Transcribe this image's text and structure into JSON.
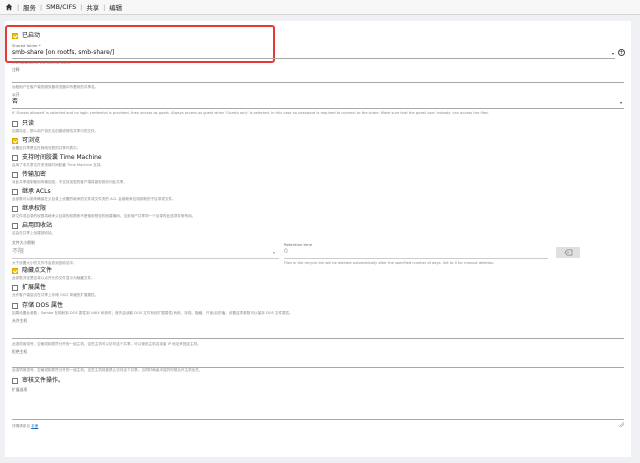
{
  "breadcrumb": [
    "服务",
    "SMB/CIFS",
    "共享",
    "编辑"
  ],
  "form": {
    "enabled": {
      "label": "已启动",
      "checked": true
    },
    "shared_folder": {
      "label": "Shared folder *",
      "value": "smb-share [on rootfs, smb-share/]",
      "hint": "The location of the files to share."
    },
    "comment": {
      "label": "注释",
      "value": "",
      "hint": "远程用户在客户端的服务器浏览器中所看到的共享名。"
    },
    "public": {
      "label": "公开",
      "value": "否",
      "hint": "If 'Guests allowed' is selected and no login credential is provided, then access as guest. Always access as guest when 'Guests only' is selected. In this case no password is required to connect to the share. Make sure that the guest user 'nobody' can access the files."
    },
    "readonly": {
      "label": "只读",
      "checked": false,
      "hint": "如果设定，那么用户将无法创建或修改共享中的文件。"
    },
    "browseable": {
      "label": "可浏览",
      "checked": true,
      "hint": "设置此共享是否在网络邻居的共享列表中。"
    },
    "time_machine": {
      "label": "支持时间胶囊 Time Machine",
      "checked": false,
      "hint": "启用了本共享文件夹采用时间胶囊 Time Machine 支持。"
    },
    "transport_encryption": {
      "label": "传输加密",
      "checked": false,
      "hint": "对此共享强制使用传输加密。不支持加密的客户端将被拒绝访问此共享。"
    },
    "inherit_acls": {
      "label": "继承 ACLs",
      "checked": false,
      "hint": "此参数可以用来确保在父目录上设置的继承的文件或文件夹的 ACL 会被继承应用到新的子目录或文件。"
    },
    "inherit_permissions": {
      "label": "继承权限",
      "checked": false,
      "hint": "新文件或目录的权限将继承父目录的权限而不是使用预设的创建掩码。当多用户共享同一个目录时此选项非常有用。"
    },
    "recycle_bin": {
      "label": "启用回收站",
      "checked": false,
      "hint": "这会在共享上创建回收站。"
    },
    "max_size": {
      "label": "文件大小限制",
      "value": "不限",
      "hint": "大于设置大小的文件不会放到回收站中。"
    },
    "retention": {
      "label": "Retention time",
      "value": "0",
      "hint": "Files in the recycle bin will be deleted automatically after the specified number of days. Set to 0 for manual deletion."
    },
    "hide_dot_files": {
      "label": "隐藏点文件",
      "checked": true,
      "hint": "此参数决定是否将以点开头的文件显示为隐藏文件。"
    },
    "extended_attributes": {
      "label": "扩展属性",
      "checked": false,
      "hint": "允许客户端尝试在共享上存储 OS/2 风格的扩展属性。"
    },
    "store_dos_attributes": {
      "label": "存储 DOS 属性",
      "checked": false,
      "hint": "如果设置此参数，Samba 在映射到 DOS 属性到 UNIX 系统时，首先会读取 DOS 文件系统扩展属性(系统、存档、隐藏、只读)后的值。设置这项参数可以保存 DOS 文件属性。"
    },
    "hosts_allow": {
      "label": "允许主机",
      "value": "",
      "hint": "此选项用逗号、空格或制表符分开的一组主机，这些主机可以访问这个共享。可以使用主机名或者 IP 地址来指定主机。"
    },
    "hosts_deny": {
      "label": "拒绝主机",
      "value": "",
      "hint": "此选项用逗号、空格或制表符分开的一组主机，这些主机将被禁止访问这个共享。当同时两者冲突的时候允许主机优先。"
    },
    "audit": {
      "label": "审核文件操作。",
      "checked": false
    },
    "extra_options": {
      "label": "扩展选项",
      "value": ""
    },
    "footer": {
      "text": "详情请参见",
      "link": "手册"
    }
  }
}
